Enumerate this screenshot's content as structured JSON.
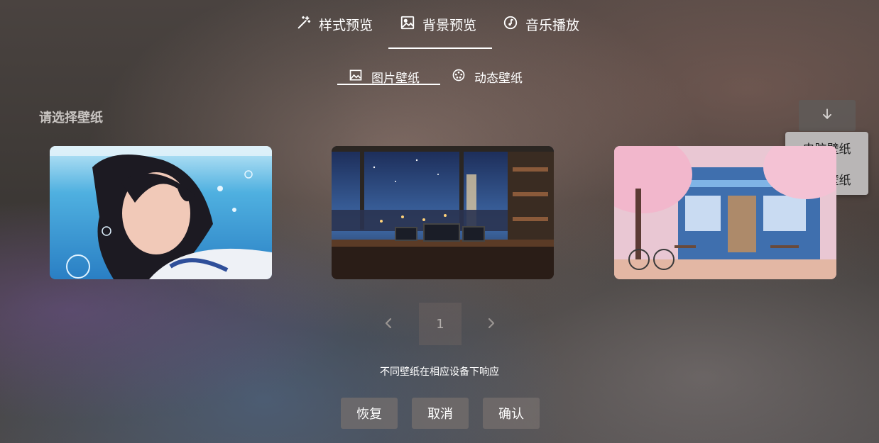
{
  "tabs": [
    {
      "label": "样式预览",
      "icon": "magic-wand-icon"
    },
    {
      "label": "背景预览",
      "icon": "image-icon",
      "active": true
    },
    {
      "label": "音乐播放",
      "icon": "music-note-icon"
    }
  ],
  "subtabs": [
    {
      "label": "图片壁纸",
      "icon": "picture-icon",
      "active": true
    },
    {
      "label": "动态壁纸",
      "icon": "film-reel-icon"
    }
  ],
  "section": {
    "title": "请选择壁纸"
  },
  "download": {
    "icon": "arrow-down-icon"
  },
  "device_menu": {
    "items": [
      "电脑壁纸",
      "手机壁纸"
    ]
  },
  "wallpapers": [
    {
      "icon": "underwater-girl-thumbnail"
    },
    {
      "icon": "night-city-desk-thumbnail"
    },
    {
      "icon": "cherry-blossom-shop-thumbnail"
    }
  ],
  "pagination": {
    "current": "1",
    "prev_icon": "chevron-left-icon",
    "next_icon": "chevron-right-icon"
  },
  "hint": "不同壁纸在相应设备下响应",
  "buttons": {
    "restore": "恢复",
    "cancel": "取消",
    "confirm": "确认"
  },
  "colors": {
    "menu_bg": "#b9b6b6",
    "text": "#ffffff",
    "section_title": "#c9c5c2"
  }
}
